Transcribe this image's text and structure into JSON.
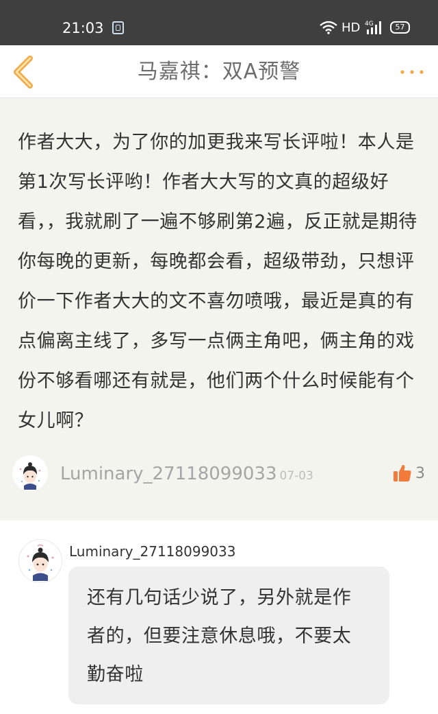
{
  "status_bar": {
    "time": "21:03",
    "network_label": "HD",
    "signal_type": "4G",
    "battery": "57",
    "icons": [
      "app-notification-icon",
      "wifi-icon",
      "signal-icon",
      "battery-icon"
    ]
  },
  "header": {
    "title": "马嘉祺：双A预警",
    "back_icon": "chevron-left-icon",
    "more_icon": "more-dots-icon",
    "accent_color": "#f0a94a"
  },
  "post": {
    "text": "作者大大，为了你的加更我来写长评啦！本人是第1次写长评哟！作者大大写的文真的超级好看，，我就刷了一遍不够刷第2遍，反正就是期待你每晚的更新，每晚都会看，超级带劲，只想评价一下作者大大的文不喜勿喷哦，最近是真的有点偏离主线了，多写一点俩主角吧，俩主角的戏份不够看哪还有就是，他们两个什么时候能有个女儿啊？",
    "author": "Luminary_27118099033",
    "date": "07-03",
    "likes": "3",
    "like_icon": "thumbs-up-icon",
    "like_color": "#f27a3a"
  },
  "reply": {
    "username": "Luminary_27118099033",
    "text": "还有几句话少说了，另外就是作者的，但要注意休息哦，不要太勤奋啦"
  }
}
